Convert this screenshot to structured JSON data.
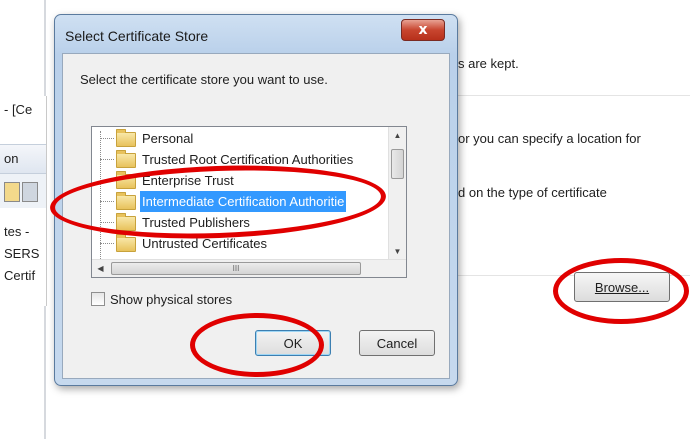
{
  "background": {
    "left_rows": [
      "- [Ce",
      "on",
      "tes -",
      "SERS",
      "Certif"
    ],
    "right_texts": [
      "s are kept.",
      "or you can specify a location for",
      "d on the type of certificate"
    ],
    "browse_label": "Browse..."
  },
  "dialog": {
    "title": "Select Certificate Store",
    "close_label": "x",
    "prompt": "Select the certificate store you want to use.",
    "stores": [
      {
        "label": "Personal",
        "selected": false
      },
      {
        "label": "Trusted Root Certification Authorities",
        "selected": false
      },
      {
        "label": "Enterprise Trust",
        "selected": false
      },
      {
        "label": "Intermediate Certification Authoritie",
        "selected": true
      },
      {
        "label": "Trusted Publishers",
        "selected": false
      },
      {
        "label": "Untrusted Certificates",
        "selected": false
      }
    ],
    "scroll_up": "▲",
    "scroll_down": "▼",
    "scroll_left": "◀",
    "scroll_right": "▶",
    "hscroll_grip": "III",
    "show_physical_label": "Show physical stores",
    "ok_label": "OK",
    "cancel_label": "Cancel"
  },
  "colors": {
    "selection": "#3399ff",
    "annotation_ring": "#e00000",
    "dialog_frame": "#b9d0ea"
  }
}
